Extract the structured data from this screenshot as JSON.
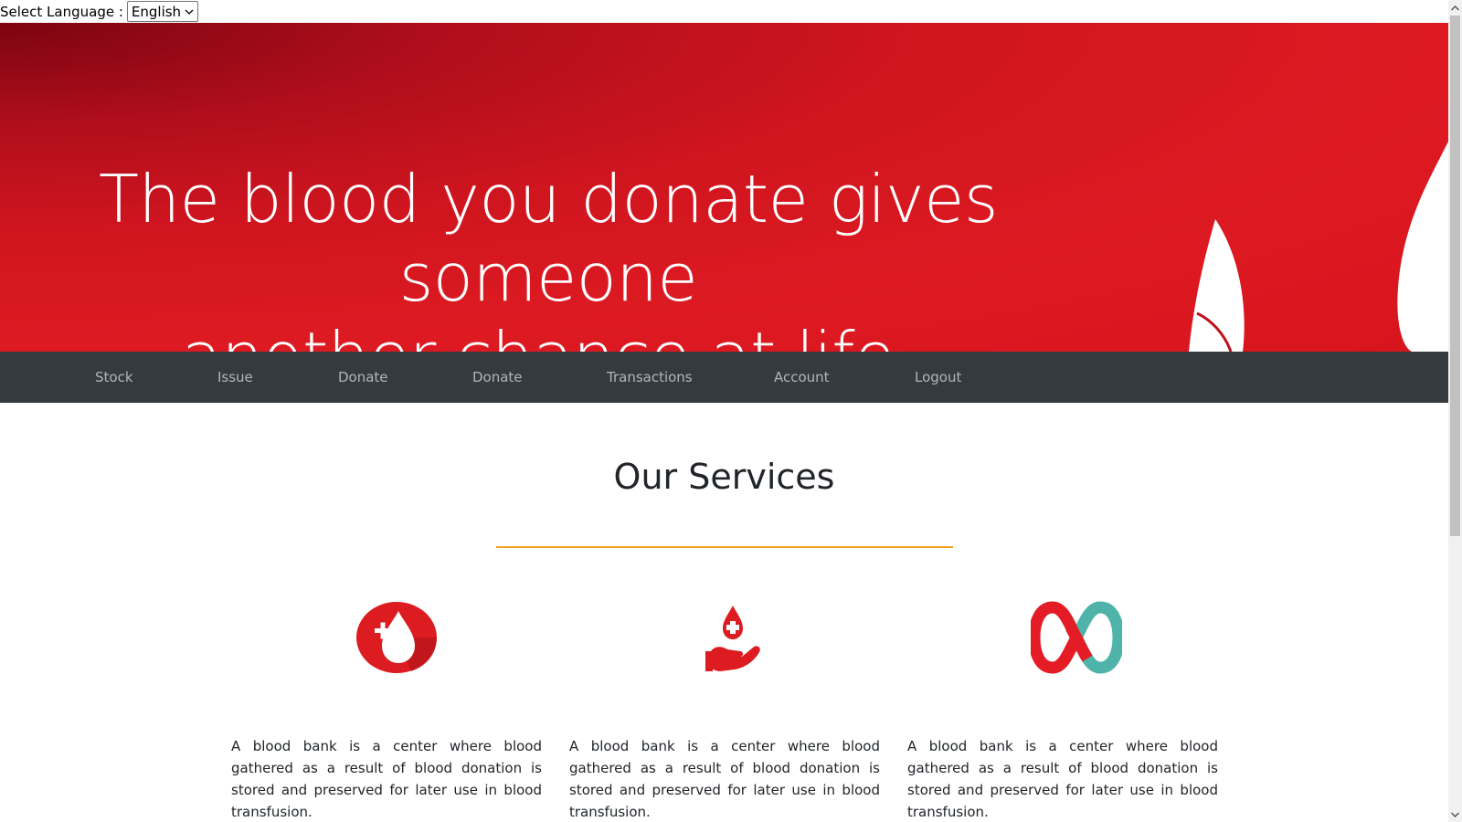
{
  "language_selector": {
    "label": "Select Language :",
    "selected": "English"
  },
  "banner": {
    "line1": "The blood you donate gives someone",
    "line2": "another chance at life."
  },
  "nav": {
    "items": [
      {
        "label": "Stock"
      },
      {
        "label": "Issue"
      },
      {
        "label": "Donate"
      },
      {
        "label": "Donate"
      },
      {
        "label": "Transactions"
      },
      {
        "label": "Account"
      },
      {
        "label": "Logout"
      }
    ]
  },
  "services": {
    "title": "Our Services",
    "accent_color": "#f0a31d",
    "cards": [
      {
        "icon": "blood-drop-plus-icon",
        "text": "A blood bank is a center where blood gathered as a result of blood donation is stored and preserved for later use in blood transfusion."
      },
      {
        "icon": "hand-holding-blood-drop-icon",
        "text": "A blood bank is a center where blood gathered as a result of blood donation is stored and preserved for later use in blood transfusion."
      },
      {
        "icon": "infinity-icon",
        "text": "A blood bank is a center where blood gathered as a result of blood donation is stored and preserved for later use in blood transfusion."
      }
    ]
  },
  "colors": {
    "banner_red": "#dd1a22",
    "nav_bg": "#343a40",
    "infinity_teal": "#4fb3a9"
  }
}
